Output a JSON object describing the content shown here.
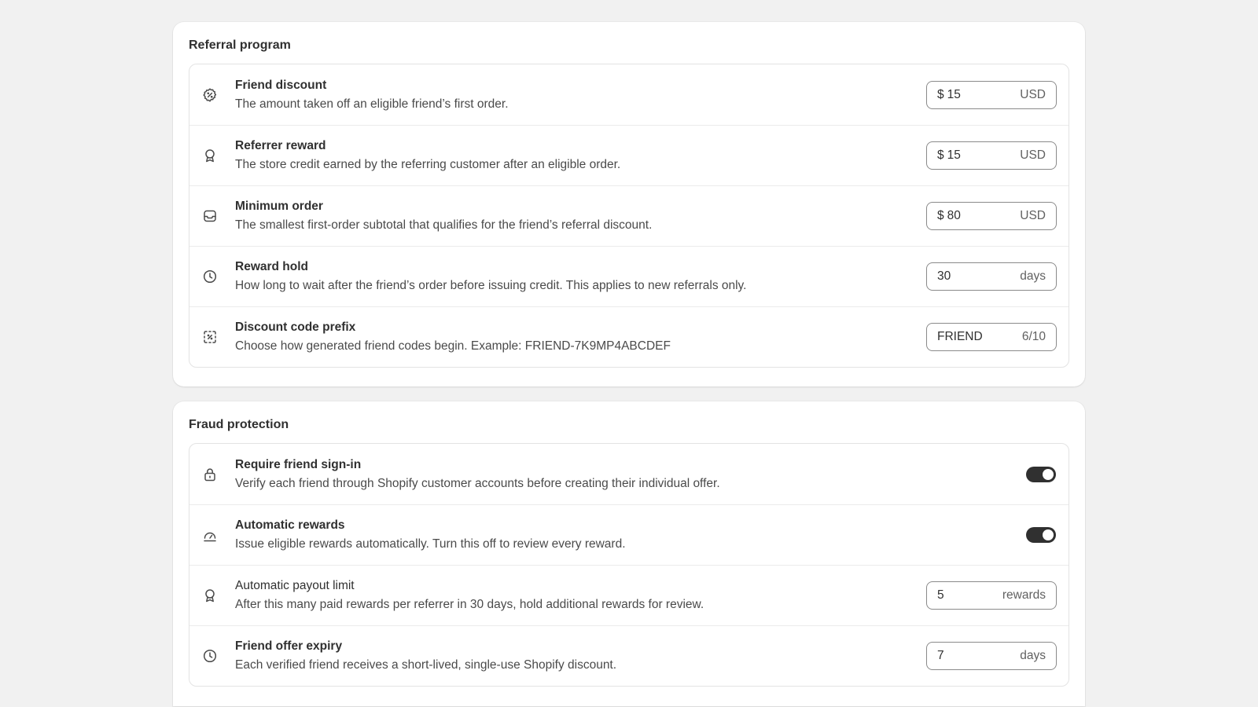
{
  "referral": {
    "title": "Referral program",
    "rows": [
      {
        "title": "Friend discount",
        "desc": "The amount taken off an eligible friend’s first order.",
        "prefix": "$",
        "value": "15",
        "suffix": "USD",
        "icon": "discount-badge-icon"
      },
      {
        "title": "Referrer reward",
        "desc": "The store credit earned by the referring customer after an eligible order.",
        "prefix": "$",
        "value": "15",
        "suffix": "USD",
        "icon": "reward-ribbon-icon"
      },
      {
        "title": "Minimum order",
        "desc": "The smallest first-order subtotal that qualifies for the friend’s referral discount.",
        "prefix": "$",
        "value": "80",
        "suffix": "USD",
        "icon": "inbox-icon"
      },
      {
        "title": "Reward hold",
        "desc": "How long to wait after the friend’s order before issuing credit. This applies to new referrals only.",
        "value": "30",
        "suffix": "days",
        "icon": "clock-icon"
      },
      {
        "title": "Discount code prefix",
        "desc": "Choose how generated friend codes begin. Example: FRIEND-7K9MP4ABCDEF",
        "value": "FRIEND",
        "suffix": "6/10",
        "icon": "discount-code-icon"
      }
    ]
  },
  "fraud": {
    "title": "Fraud protection",
    "rows": [
      {
        "title": "Require friend sign-in",
        "desc": "Verify each friend through Shopify customer accounts before creating their individual offer.",
        "toggle": "on",
        "icon": "lock-icon"
      },
      {
        "title": "Automatic rewards",
        "desc": "Issue eligible rewards automatically. Turn this off to review every reward.",
        "toggle": "on",
        "icon": "gauge-icon"
      },
      {
        "title": "Automatic payout limit",
        "desc": "After this many paid rewards per referrer in 30 days, hold additional rewards for review.",
        "value": "5",
        "suffix": "rewards",
        "icon": "reward-ribbon-icon"
      },
      {
        "title": "Friend offer expiry",
        "desc": "Each verified friend receives a short-lived, single-use Shopify discount.",
        "value": "7",
        "suffix": "days",
        "icon": "clock-icon"
      }
    ]
  },
  "colors": {
    "background": "#f1f1f1",
    "card": "#ffffff",
    "toggle_on": "#303030",
    "text": "#303030"
  }
}
